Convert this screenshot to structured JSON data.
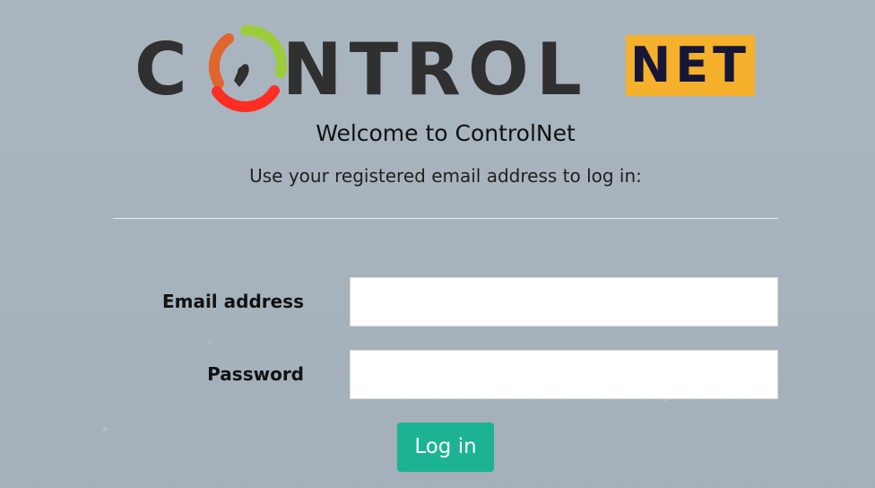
{
  "brand": {
    "name_part_1": "C",
    "name_part_2": "NTROL",
    "net_badge": "NET",
    "colors": {
      "dark": "#303030",
      "orange": "#e0662d",
      "green": "#9ccc3d",
      "red": "#ff2d22",
      "badge": "#f5b12c",
      "badge_text": "#161638"
    }
  },
  "header": {
    "welcome": "Welcome to ControlNet",
    "subtitle": "Use your registered email address to log in:"
  },
  "form": {
    "email_label": "Email address",
    "email_value": "",
    "email_placeholder": "",
    "password_label": "Password",
    "password_value": "",
    "password_placeholder": "",
    "login_button": "Log in"
  },
  "colors": {
    "background": "#a7b3bd",
    "primary_button": "#1bb394",
    "input_background": "#ffffff",
    "divider": "#e8edf1"
  }
}
